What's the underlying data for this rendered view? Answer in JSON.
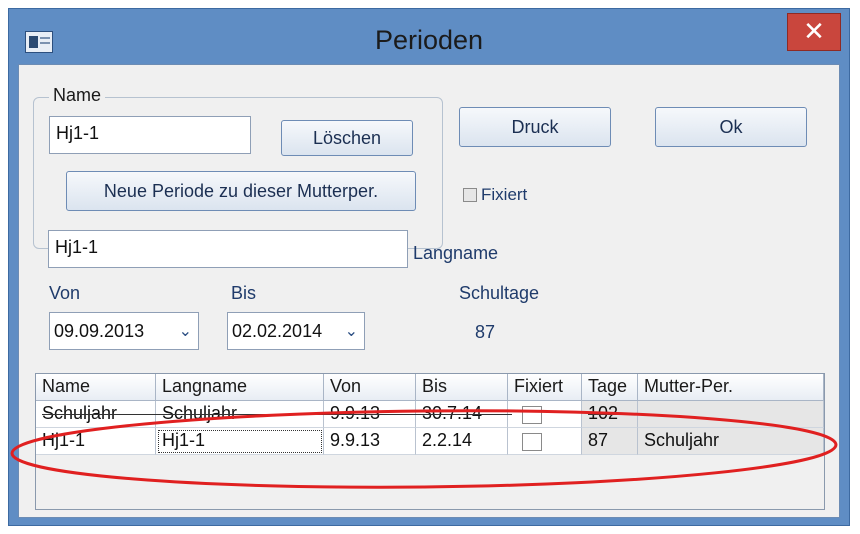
{
  "window": {
    "title": "Perioden",
    "close_symbol": "✕"
  },
  "group": {
    "label": "Name",
    "name_value": "Hj1-1",
    "delete_label": "Löschen",
    "new_period_label": "Neue Periode zu dieser Mutterper."
  },
  "buttons": {
    "print_label": "Druck",
    "ok_label": "Ok"
  },
  "fixed_checkbox": {
    "label": "Fixiert",
    "checked": false
  },
  "longname": {
    "value": "Hj1-1",
    "label": "Langname"
  },
  "from": {
    "label": "Von",
    "value": "09.09.2013"
  },
  "to": {
    "label": "Bis",
    "value": "02.02.2014"
  },
  "school_days": {
    "label": "Schultage",
    "value": "87"
  },
  "table": {
    "columns": [
      "Name",
      "Langname",
      "Von",
      "Bis",
      "Fixiert",
      "Tage",
      "Mutter-Per."
    ],
    "rows": [
      {
        "name": "Schuljahr",
        "longname": "Schuljahr",
        "from": "9.9.13",
        "to": "30.7.14",
        "fixed": false,
        "days": "102",
        "parent": ""
      },
      {
        "name": "Hj1-1",
        "longname": "Hj1-1",
        "from": "9.9.13",
        "to": "2.2.14",
        "fixed": false,
        "days": "87",
        "parent": "Schuljahr"
      }
    ]
  },
  "colors": {
    "title_bar": "#5f8dc4",
    "close": "#c9463d",
    "annotation": "#e02020",
    "label_text": "#1f3b6b"
  }
}
